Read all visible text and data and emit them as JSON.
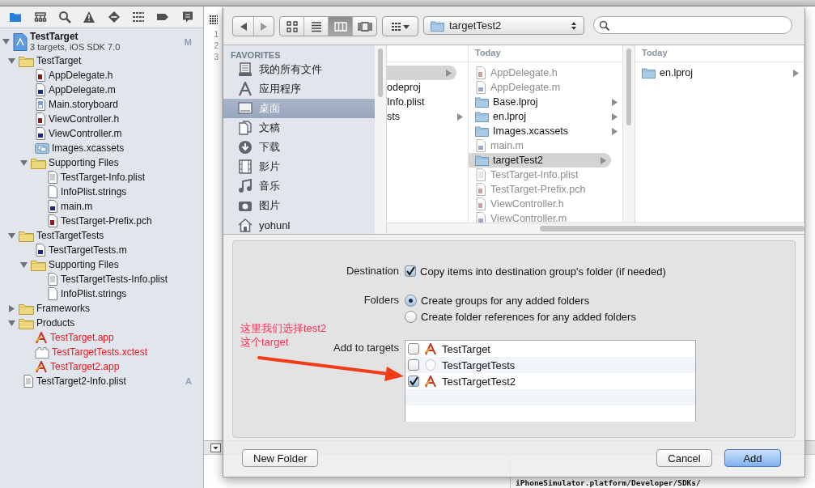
{
  "navigator": {
    "tabs": [
      {
        "kind": "project",
        "selected": true
      },
      {
        "kind": "symbols",
        "selected": false
      },
      {
        "kind": "find",
        "selected": false
      },
      {
        "kind": "issues",
        "selected": false
      },
      {
        "kind": "tests",
        "selected": false
      },
      {
        "kind": "debug",
        "selected": false
      },
      {
        "kind": "breakpoints",
        "selected": false
      },
      {
        "kind": "log",
        "selected": false
      }
    ],
    "project": {
      "name": "TestTarget",
      "subtitle": "3 targets, iOS SDK 7.0",
      "badge": "M",
      "expanded": true
    },
    "tree": [
      {
        "name": "TestTarget",
        "kind": "folder",
        "expanded": true,
        "children": [
          {
            "name": "AppDelegate.h",
            "kind": "h"
          },
          {
            "name": "AppDelegate.m",
            "kind": "m"
          },
          {
            "name": "Main.storyboard",
            "kind": "storyboard"
          },
          {
            "name": "ViewController.h",
            "kind": "h"
          },
          {
            "name": "ViewController.m",
            "kind": "m"
          },
          {
            "name": "Images.xcassets",
            "kind": "assets"
          },
          {
            "name": "Supporting Files",
            "kind": "folder",
            "expanded": true,
            "children": [
              {
                "name": "TestTarget-Info.plist",
                "kind": "plist"
              },
              {
                "name": "InfoPlist.strings",
                "kind": "strings"
              },
              {
                "name": "main.m",
                "kind": "m"
              },
              {
                "name": "TestTarget-Prefix.pch",
                "kind": "h"
              }
            ]
          }
        ]
      },
      {
        "name": "TestTargetTests",
        "kind": "folder",
        "expanded": true,
        "children": [
          {
            "name": "TestTargetTests.m",
            "kind": "m"
          },
          {
            "name": "Supporting Files",
            "kind": "folder",
            "expanded": true,
            "children": [
              {
                "name": "TestTargetTests-Info.plist",
                "kind": "plist"
              },
              {
                "name": "InfoPlist.strings",
                "kind": "strings"
              }
            ]
          }
        ]
      },
      {
        "name": "Frameworks",
        "kind": "folder",
        "expanded": false
      },
      {
        "name": "Products",
        "kind": "folder",
        "expanded": true,
        "children": [
          {
            "name": "TestTarget.app",
            "kind": "app",
            "missing": true
          },
          {
            "name": "TestTargetTests.xctest",
            "kind": "bundle",
            "missing": true
          },
          {
            "name": "TestTarget2.app",
            "kind": "app",
            "missing": true
          }
        ]
      },
      {
        "name": "TestTarget2-Info.plist",
        "kind": "plist",
        "badge": "A"
      }
    ]
  },
  "editor": {
    "line_numbers": [
      "1",
      "2",
      "3"
    ],
    "console_lines": [
      "iPhoneSimulator.platform/Developer/SDKs/"
    ]
  },
  "dialog": {
    "toolbar": {
      "view_modes": [
        {
          "kind": "icons",
          "selected": false
        },
        {
          "kind": "list",
          "selected": false
        },
        {
          "kind": "columns",
          "selected": true
        },
        {
          "kind": "coverflow",
          "selected": false
        }
      ],
      "path": "targetTest2"
    },
    "sidebar": {
      "heading": "FAVORITES",
      "items": [
        {
          "kind": "all-files",
          "label": "我的所有文件",
          "selected": false
        },
        {
          "kind": "applications",
          "label": "应用程序",
          "selected": false
        },
        {
          "kind": "desktop",
          "label": "桌面",
          "selected": true
        },
        {
          "kind": "documents",
          "label": "文稿",
          "selected": false
        },
        {
          "kind": "downloads",
          "label": "下载",
          "selected": false
        },
        {
          "kind": "movies",
          "label": "影片",
          "selected": false
        },
        {
          "kind": "music",
          "label": "音乐",
          "selected": false
        },
        {
          "kind": "pictures",
          "label": "图片",
          "selected": false
        },
        {
          "kind": "home",
          "label": "yohunl",
          "selected": false
        }
      ]
    },
    "columns": [
      {
        "items": [
          {
            "selected": true,
            "has_children": true
          },
          {
            "label": "odeproj",
            "selected": false
          },
          {
            "label": "Info.plist",
            "selected": false
          },
          {
            "label": "sts",
            "selected": false,
            "has_children": true
          }
        ]
      },
      {
        "heading": "Today",
        "items": [
          {
            "kind": "h",
            "label": "AppDelegate.h",
            "dimmed": true,
            "selected": false
          },
          {
            "kind": "m",
            "label": "AppDelegate.m",
            "dimmed": true,
            "selected": false
          },
          {
            "kind": "folder",
            "label": "Base.lproj",
            "selected": false,
            "has_children": true
          },
          {
            "kind": "folder",
            "label": "en.lproj",
            "selected": false,
            "has_children": true
          },
          {
            "kind": "folder",
            "label": "Images.xcassets",
            "selected": false,
            "has_children": true
          },
          {
            "kind": "m",
            "label": "main.m",
            "dimmed": true,
            "selected": false
          },
          {
            "kind": "folder",
            "label": "targetTest2",
            "selected": true,
            "has_children": true
          },
          {
            "kind": "plist",
            "label": "TestTarget-Info.plist",
            "dimmed": true,
            "selected": false
          },
          {
            "kind": "h",
            "label": "TestTarget-Prefix.pch",
            "dimmed": true,
            "selected": false
          },
          {
            "kind": "h",
            "label": "ViewController.h",
            "dimmed": true,
            "selected": false
          },
          {
            "kind": "m",
            "label": "ViewController.m",
            "dimmed": true,
            "selected": false
          }
        ]
      },
      {
        "heading": "Today",
        "items": [
          {
            "kind": "folder",
            "label": "en.lproj",
            "selected": false,
            "has_children": true
          }
        ]
      }
    ],
    "options": {
      "destination": {
        "label": "Destination",
        "checkbox": {
          "label": "Copy items into destination group's folder (if needed)",
          "checked": true
        }
      },
      "folders": {
        "label": "Folders",
        "choices": [
          {
            "label": "Create groups for any added folders",
            "selected": true
          },
          {
            "label": "Create folder references for any added folders",
            "selected": false
          }
        ]
      },
      "targets": {
        "label": "Add to targets",
        "items": [
          {
            "label": "TestTarget",
            "kind": "app",
            "checked": false
          },
          {
            "label": "TestTargetTests",
            "kind": "test",
            "checked": false
          },
          {
            "label": "TestTargetTest2",
            "kind": "app",
            "checked": true
          }
        ]
      }
    },
    "annotation": [
      "这里我们选择test2",
      "这个target"
    ],
    "buttons": {
      "left": [
        {
          "label": "New Folder",
          "default": false
        }
      ],
      "right": [
        {
          "label": "Cancel",
          "default": false
        },
        {
          "label": "Add",
          "default": true
        }
      ]
    }
  }
}
